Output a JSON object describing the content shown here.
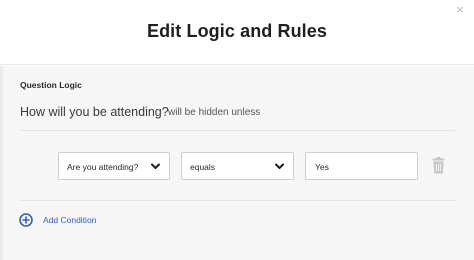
{
  "modal": {
    "title": "Edit Logic and Rules",
    "close_label": "×"
  },
  "logic": {
    "section_title": "Question Logic",
    "question": "How will you be attending?",
    "hidden_text": "will be hidden unless"
  },
  "condition": {
    "question_select": "Are you attending?",
    "operator_select": "equals",
    "value": "Yes"
  },
  "actions": {
    "add_condition": "Add Condition"
  },
  "icons": {
    "close": "close-icon",
    "chevron": "chevron-down-icon",
    "trash": "trash-icon",
    "add": "plus-circle-icon"
  },
  "colors": {
    "accent": "#3a5bbf",
    "background": "#f7f7f8",
    "icon_muted": "#c4c4c4"
  }
}
